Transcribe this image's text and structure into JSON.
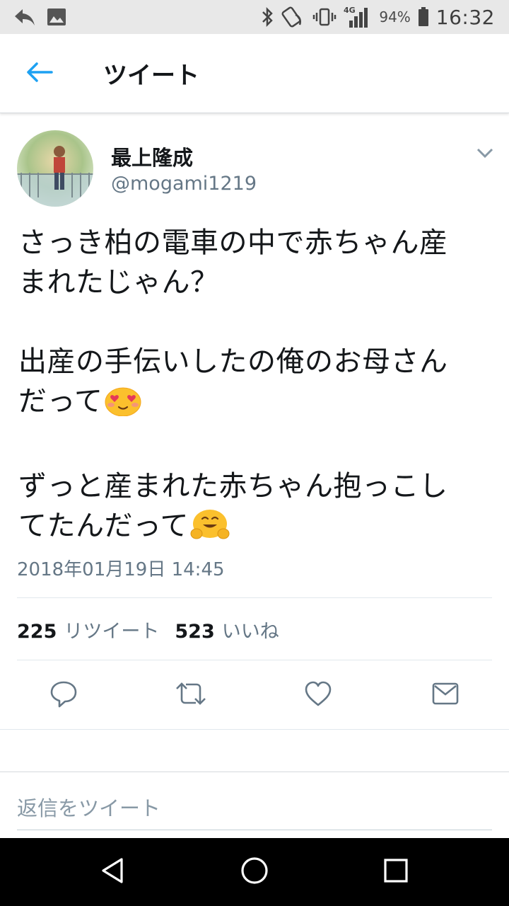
{
  "status_bar": {
    "battery_percent": "94%",
    "time": "16:32",
    "network": "4G",
    "icons": [
      "reply-arrow-icon",
      "image-icon",
      "bluetooth-icon",
      "nfc-icon",
      "vibrate-icon",
      "signal-icon",
      "battery-icon"
    ]
  },
  "app_bar": {
    "title": "ツイート",
    "back_icon": "arrow-left-icon"
  },
  "tweet": {
    "display_name": "最上隆成",
    "handle": "@mogami1219",
    "lines": [
      "さっき柏の電車の中で赤ちゃん産",
      "まれたじゃん？",
      "",
      "出産の手伝いしたの俺のお母さん",
      "だって",
      "",
      "ずっと産まれた赤ちゃん抱っこし",
      "てたんだって"
    ],
    "timestamp": "2018年01月19日 14:45",
    "retweet_count": "225",
    "retweet_label": "リツイート",
    "like_count": "523",
    "like_label": "いいね"
  },
  "actions": [
    "reply-icon",
    "retweet-icon",
    "like-icon",
    "message-icon"
  ],
  "reply_box": {
    "placeholder": "返信をツイート"
  },
  "nav_bar": [
    "back-triangle-icon",
    "home-circle-icon",
    "recents-square-icon"
  ],
  "colors": {
    "accent": "#1da1f2",
    "secondary_text": "#657786",
    "primary_text": "#14171a"
  }
}
